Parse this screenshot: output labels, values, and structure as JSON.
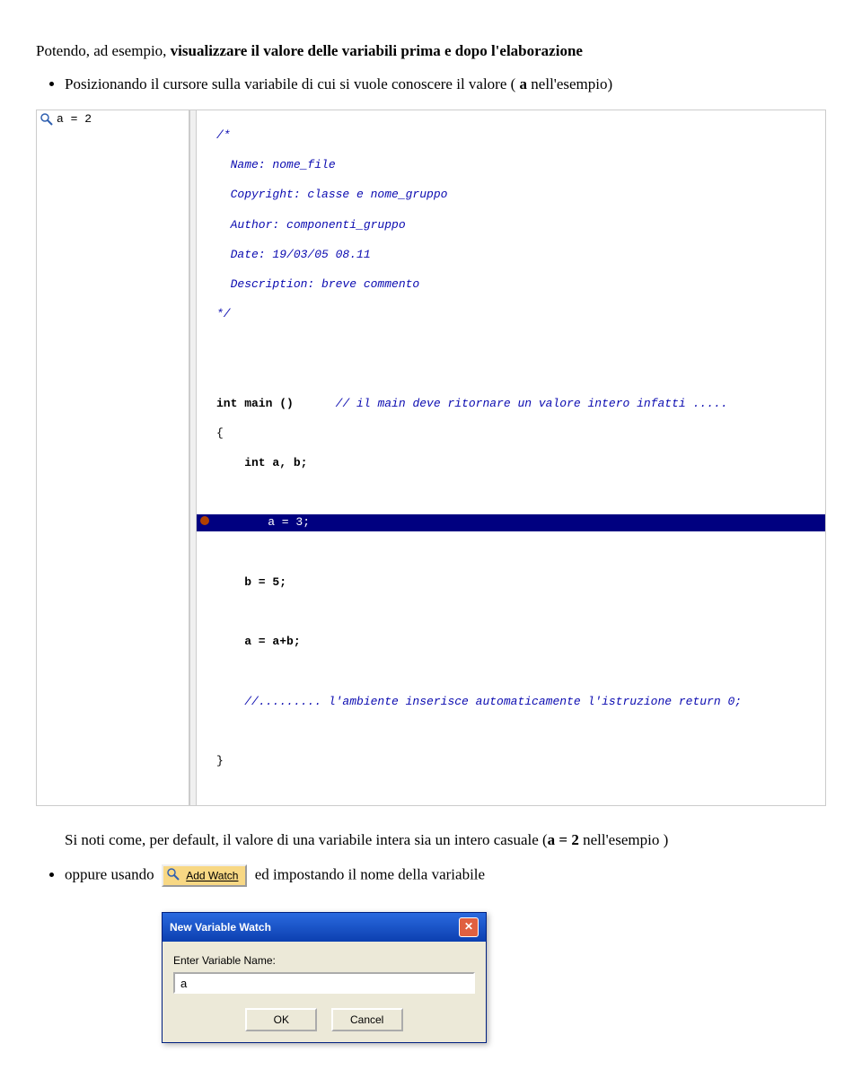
{
  "intro": {
    "sentence_prefix": "Potendo, ad esempio, ",
    "sentence_bold": "visualizzare il valore delle variabili prima e dopo l'elaborazione"
  },
  "bullet1": {
    "prefix": "Posizionando il cursore sulla variabile di cui si vuole conoscere il valore ( ",
    "bold": "a",
    "suffix": " nell'esempio)"
  },
  "ide": {
    "watch_value": "a = 2",
    "code": {
      "c_open": "/*",
      "c1": "  Name: nome_file",
      "c2": "  Copyright: classe e nome_gruppo",
      "c3": "  Author: componenti_gruppo",
      "c4": "  Date: 19/03/05 08.11",
      "c5": "  Description: breve commento",
      "c_close": "*/",
      "main_sig": "int main ()",
      "main_comment": "// il main deve ritornare un valore intero infatti .....",
      "brace_open": "{",
      "decl": "    int a, b;",
      "assign_a": "    a = 3;",
      "assign_b": "    b = 5;",
      "assign_sum": "    a = a+b;",
      "return_comment": "    //......... l'ambiente inserisce automaticamente l'istruzione return 0;",
      "brace_close": "}"
    }
  },
  "note": {
    "prefix": "Si noti come, per default, il valore di una variabile intera sia un intero casuale (",
    "bold": "a = 2",
    "suffix": " nell'esempio )"
  },
  "bullet2": {
    "prefix": "oppure usando ",
    "btn_label": "Add Watch",
    "suffix": " ed impostando il nome della variabile"
  },
  "dialog": {
    "title": "New Variable Watch",
    "label": "Enter Variable Name:",
    "value": "a",
    "ok": "OK",
    "cancel": "Cancel"
  }
}
